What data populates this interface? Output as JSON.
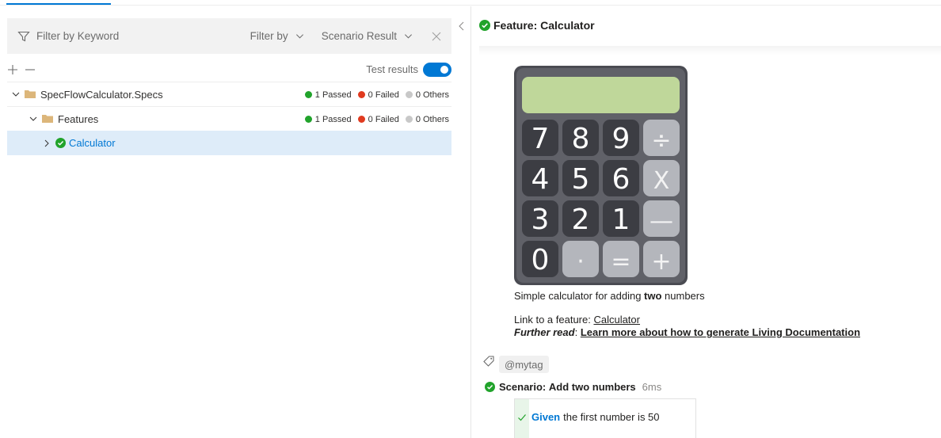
{
  "filter": {
    "keyword_placeholder": "Filter by Keyword",
    "filter_by_label": "Filter by",
    "scenario_result_label": "Scenario Result"
  },
  "toolbar": {
    "test_results_label": "Test results",
    "test_results_enabled": true
  },
  "tree": {
    "items": [
      {
        "name": "SpecFlowCalculator.Specs",
        "level": 0,
        "type": "folder",
        "expanded": true,
        "passed": "1 Passed",
        "failed": "0 Failed",
        "others": "0 Others"
      },
      {
        "name": "Features",
        "level": 1,
        "type": "folder",
        "expanded": true,
        "passed": "1 Passed",
        "failed": "0 Failed",
        "others": "0 Others"
      },
      {
        "name": "Calculator",
        "level": 2,
        "type": "feature",
        "expanded": false,
        "selected": true,
        "status": "passed"
      }
    ]
  },
  "feature": {
    "label": "Feature:",
    "title": "Calculator",
    "description_pre": "Simple calculator for adding ",
    "description_bold": "two",
    "description_post": " numbers",
    "link_prefix": "Link to a feature: ",
    "link_text": "Calculator",
    "further_label": "Further read",
    "further_sep": ": ",
    "further_link": "Learn more about how to generate Living Documentation",
    "calculator_keys": [
      "7",
      "8",
      "9",
      "÷",
      "4",
      "5",
      "6",
      "X",
      "3",
      "2",
      "1",
      "—",
      "0",
      "·",
      "=",
      "+"
    ]
  },
  "tag": {
    "text": "@mytag"
  },
  "scenario": {
    "label": "Scenario:",
    "title": "Add two numbers",
    "duration": "6ms",
    "steps": [
      {
        "keyword": "Given",
        "text": "the first number is 50"
      }
    ]
  },
  "colors": {
    "accent": "#0078d4",
    "passed": "#21a32b",
    "failed": "#e03a1f",
    "others": "#c8c8c8",
    "folder": "#dcb67a"
  }
}
